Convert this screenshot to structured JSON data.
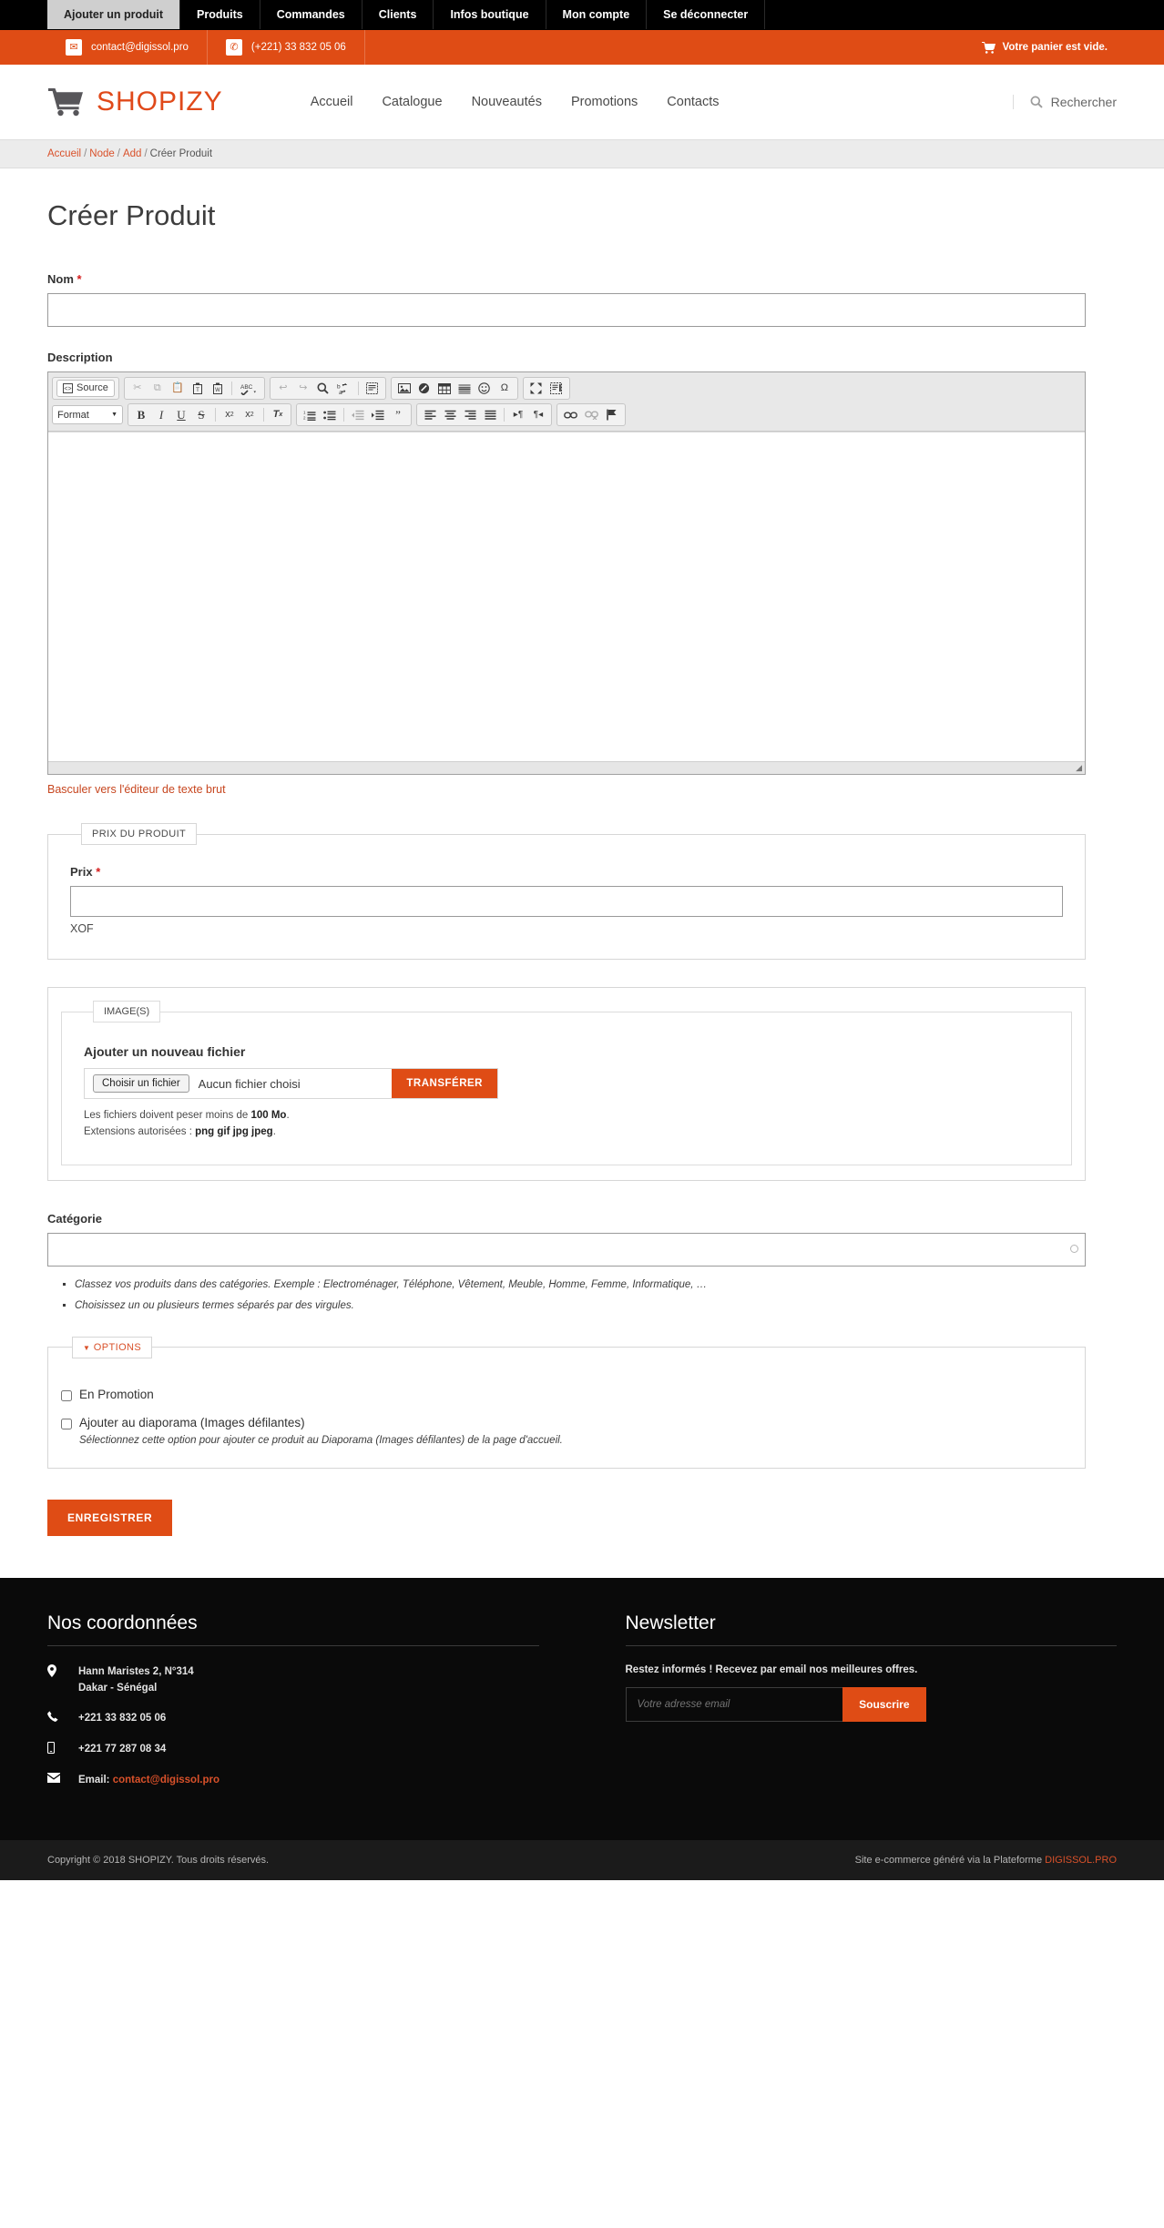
{
  "admin_tabs": [
    {
      "label": "Ajouter un produit",
      "active": true
    },
    {
      "label": "Produits",
      "active": false
    },
    {
      "label": "Commandes",
      "active": false
    },
    {
      "label": "Clients",
      "active": false
    },
    {
      "label": "Infos boutique",
      "active": false
    },
    {
      "label": "Mon compte",
      "active": false
    },
    {
      "label": "Se déconnecter",
      "active": false
    }
  ],
  "contact_bar": {
    "email": "contact@digissol.pro",
    "phone": "(+221) 33 832 05 06",
    "cart_text": "Votre panier est vide."
  },
  "header": {
    "logo": "SHOPIZY",
    "nav": [
      "Accueil",
      "Catalogue",
      "Nouveautés",
      "Promotions",
      "Contacts"
    ],
    "search_label": "Rechercher"
  },
  "breadcrumb": [
    "Accueil",
    "Node",
    "Add",
    "Créer Produit"
  ],
  "page": {
    "title": "Créer Produit",
    "name_label": "Nom",
    "name_value": "",
    "description_label": "Description",
    "switch_editor_link": "Basculer vers l'éditeur de texte brut"
  },
  "editor": {
    "source_label": "Source",
    "format_label": "Format",
    "row1": [
      {
        "g": 1,
        "icon": "source-view-icon",
        "glyph": "Source",
        "dim": false
      },
      {
        "g": 2,
        "icon": "cut-icon",
        "glyph": "✂",
        "dim": true
      },
      {
        "g": 2,
        "icon": "copy-icon",
        "glyph": "❐",
        "dim": true
      },
      {
        "g": 2,
        "icon": "paste-icon",
        "glyph": "📋",
        "dim": false
      },
      {
        "g": 2,
        "icon": "paste-text-icon",
        "glyph": "T",
        "dim": false
      },
      {
        "g": 2,
        "icon": "paste-word-icon",
        "glyph": "W",
        "dim": false
      },
      {
        "g": 2,
        "icon": "spellcheck-icon",
        "glyph": "ABC",
        "dim": false
      },
      {
        "g": 3,
        "icon": "undo-icon",
        "glyph": "↩",
        "dim": true
      },
      {
        "g": 3,
        "icon": "redo-icon",
        "glyph": "↪",
        "dim": true
      },
      {
        "g": 3,
        "icon": "find-icon",
        "glyph": "🔍",
        "dim": false
      },
      {
        "g": 3,
        "icon": "replace-icon",
        "glyph": "ba",
        "dim": false
      },
      {
        "g": 3,
        "icon": "select-all-icon",
        "glyph": "▤",
        "dim": false
      },
      {
        "g": 4,
        "icon": "image-icon",
        "glyph": "🖼",
        "dim": false
      },
      {
        "g": 4,
        "icon": "flash-icon",
        "glyph": "◕",
        "dim": false
      },
      {
        "g": 4,
        "icon": "table-icon",
        "glyph": "▦",
        "dim": false
      },
      {
        "g": 4,
        "icon": "horizontal-rule-icon",
        "glyph": "≡",
        "dim": false
      },
      {
        "g": 4,
        "icon": "smiley-icon",
        "glyph": "☺",
        "dim": false
      },
      {
        "g": 4,
        "icon": "special-char-icon",
        "glyph": "Ω",
        "dim": false
      },
      {
        "g": 5,
        "icon": "maximize-icon",
        "glyph": "⤢",
        "dim": false
      },
      {
        "g": 5,
        "icon": "show-blocks-icon",
        "glyph": "▤",
        "dim": false
      }
    ],
    "row2": [
      {
        "g": 2,
        "icon": "bold-icon",
        "glyph": "B",
        "dim": false
      },
      {
        "g": 2,
        "icon": "italic-icon",
        "glyph": "I",
        "dim": false
      },
      {
        "g": 2,
        "icon": "underline-icon",
        "glyph": "U",
        "dim": false
      },
      {
        "g": 2,
        "icon": "strikethrough-icon",
        "glyph": "S",
        "dim": false
      },
      {
        "g": 2,
        "icon": "subscript-icon",
        "glyph": "x₂",
        "dim": false
      },
      {
        "g": 2,
        "icon": "superscript-icon",
        "glyph": "x²",
        "dim": false
      },
      {
        "g": 2,
        "icon": "remove-format-icon",
        "glyph": "Tx",
        "dim": false
      },
      {
        "g": 3,
        "icon": "numbered-list-icon",
        "glyph": "1≡",
        "dim": false
      },
      {
        "g": 3,
        "icon": "bulleted-list-icon",
        "glyph": "•≡",
        "dim": false
      },
      {
        "g": 3,
        "icon": "outdent-icon",
        "glyph": "⇤≡",
        "dim": true
      },
      {
        "g": 3,
        "icon": "indent-icon",
        "glyph": "⇥≡",
        "dim": false
      },
      {
        "g": 3,
        "icon": "blockquote-icon",
        "glyph": "❞",
        "dim": false
      },
      {
        "g": 4,
        "icon": "align-left-icon",
        "glyph": "≡",
        "dim": false
      },
      {
        "g": 4,
        "icon": "align-center-icon",
        "glyph": "≡",
        "dim": false
      },
      {
        "g": 4,
        "icon": "align-right-icon",
        "glyph": "≡",
        "dim": false
      },
      {
        "g": 4,
        "icon": "align-justify-icon",
        "glyph": "≡",
        "dim": false
      },
      {
        "g": 4,
        "icon": "ltr-icon",
        "glyph": "▸¶",
        "dim": false
      },
      {
        "g": 4,
        "icon": "rtl-icon",
        "glyph": "¶◂",
        "dim": false
      },
      {
        "g": 5,
        "icon": "link-icon",
        "glyph": "🔗",
        "dim": false
      },
      {
        "g": 5,
        "icon": "unlink-icon",
        "glyph": "🔗",
        "dim": true
      },
      {
        "g": 5,
        "icon": "anchor-icon",
        "glyph": "⚑",
        "dim": false
      }
    ],
    "content": ""
  },
  "price_fieldset": {
    "legend": "PRIX DU PRODUIT",
    "label": "Prix",
    "value": "",
    "currency": "XOF"
  },
  "images_fieldset": {
    "legend": "IMAGE(S)",
    "add_file_title": "Ajouter un nouveau fichier",
    "choose_button": "Choisir un fichier",
    "no_file_text": "Aucun fichier choisi",
    "upload_button": "TRANSFÉRER",
    "hint_size_prefix": "Les fichiers doivent peser moins de ",
    "hint_size_value": "100 Mo",
    "hint_size_suffix": ".",
    "hint_ext_prefix": "Extensions autorisées : ",
    "hint_ext_value": "png gif jpg jpeg",
    "hint_ext_suffix": "."
  },
  "category": {
    "label": "Catégorie",
    "value": "",
    "notes": [
      "Classez vos produits dans des catégories. Exemple : Electroménager, Téléphone, Vêtement, Meuble, Homme, Femme, Informatique, …",
      "Choisissez un ou plusieurs termes séparés par des virgules."
    ]
  },
  "options_fieldset": {
    "legend": "OPTIONS",
    "promo_label": "En Promotion",
    "promo_checked": false,
    "slider_label": "Ajouter au diaporama (Images défilantes)",
    "slider_checked": false,
    "slider_desc": "Sélectionnez cette option pour ajouter ce produit au Diaporama (Images défilantes) de la page d'accueil."
  },
  "save_button": "ENREGISTRER",
  "footer": {
    "contact_title": "Nos coordonnées",
    "address_line1": "Hann Maristes 2, N°314",
    "address_line2": "Dakar - Sénégal",
    "phone_fixed": "+221 33 832 05 06",
    "phone_mobile": "+221 77 287 08 34",
    "email_label": "Email:",
    "email_value": "contact@digissol.pro",
    "newsletter_title": "Newsletter",
    "newsletter_note": "Restez informés ! Recevez par email nos meilleures offres.",
    "newsletter_placeholder": "Votre adresse email",
    "newsletter_button": "Souscrire",
    "copyright": "Copyright © 2018 SHOPIZY. Tous droits réservés.",
    "generated_prefix": "Site e-commerce généré via la Plateforme ",
    "generated_link": "DIGISSOL.PRO"
  },
  "colors": {
    "brand_orange": "#df4c15",
    "link_orange": "#d9512a",
    "header_black": "#000000",
    "footer_black": "#0a0a0a"
  }
}
